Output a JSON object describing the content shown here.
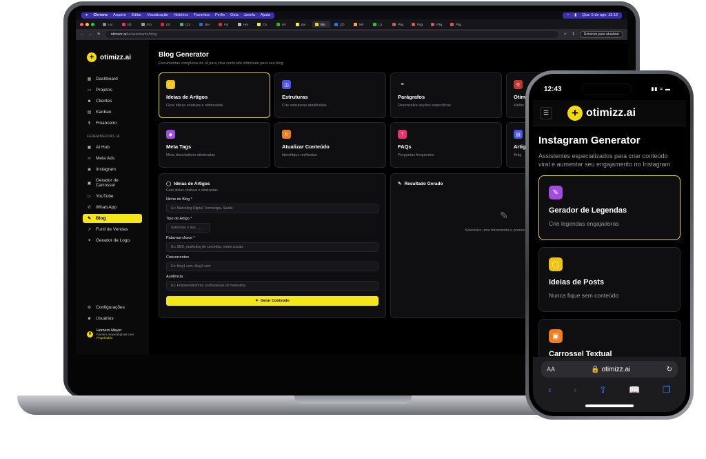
{
  "menubar": {
    "apple": "",
    "app": "Chrome",
    "items": [
      "Arquivo",
      "Editar",
      "Visualização",
      "Histórico",
      "Favoritos",
      "Perfis",
      "Guia",
      "Janela",
      "Ajuda"
    ],
    "clock": "Qua. 6 de ago.  13:13"
  },
  "tabs": [
    {
      "label": "Lor",
      "color": "#888"
    },
    {
      "label": "(6)",
      "color": "#e1306c"
    },
    {
      "label": "Fro",
      "color": "#999"
    },
    {
      "label": "(3)",
      "color": "#d24"
    },
    {
      "label": "(12",
      "color": "#4a8"
    },
    {
      "label": "Ner",
      "color": "#36c"
    },
    {
      "label": "Inb",
      "color": "#c33"
    },
    {
      "label": "Hei",
      "color": "#bbb"
    },
    {
      "label": "Ca",
      "color": "#ee3"
    },
    {
      "label": "(At",
      "color": "#2b2"
    },
    {
      "label": "par",
      "color": "#ff0"
    },
    {
      "label": "Blo",
      "color": "#f5d90a",
      "active": true
    },
    {
      "label": "(20",
      "color": "#1877f2"
    },
    {
      "label": "Mil",
      "color": "#fa3"
    },
    {
      "label": "La",
      "color": "#1c4"
    },
    {
      "label": "Pág",
      "color": "#c55"
    },
    {
      "label": "Pág",
      "color": "#c55"
    },
    {
      "label": "Pág",
      "color": "#c55"
    },
    {
      "label": "Pág",
      "color": "#c55"
    }
  ],
  "addressbar": {
    "url_host": "otimizz.ai",
    "url_path": "/ia/assistants/blog",
    "restart_label": "Reiniciar para atualizar"
  },
  "brand": {
    "name": "otimizz.ai",
    "accent": "#f5e619"
  },
  "sidebar": {
    "items": [
      {
        "label": "Dashboard",
        "icon": "grid-icon"
      },
      {
        "label": "Projetos",
        "icon": "folder-icon"
      },
      {
        "label": "Clientes",
        "icon": "users-icon"
      },
      {
        "label": "Kanban",
        "icon": "kanban-icon"
      },
      {
        "label": "Financeiro",
        "icon": "dollar-icon"
      }
    ],
    "section_label": "FERRAMENTAS IA",
    "tools": [
      {
        "label": "AI Hub",
        "icon": "ai-hub-icon"
      },
      {
        "label": "Meta Ads",
        "icon": "meta-icon"
      },
      {
        "label": "Instagram",
        "icon": "camera-icon"
      },
      {
        "label": "Gerador de Carrossel",
        "icon": "image-icon"
      },
      {
        "label": "YouTube",
        "icon": "play-icon"
      },
      {
        "label": "WhatsApp",
        "icon": "whatsapp-icon"
      },
      {
        "label": "Blog",
        "icon": "blog-icon",
        "active": true
      },
      {
        "label": "Funil de Vendas",
        "icon": "trend-icon"
      },
      {
        "label": "Gerador de Logo",
        "icon": "sparkle-icon"
      }
    ],
    "settings_label": "Configurações",
    "users_label": "Usuários",
    "user": {
      "initial": "H",
      "name": "Homero Meyer",
      "email": "homero.meyer@gmail.com",
      "role": "Proprietário"
    }
  },
  "main": {
    "title": "Blog Generator",
    "subtitle": "Ferramentas completas de IA para criar conteúdo otimizado para seu blog",
    "cards": [
      {
        "title": "Ideias de Artigos",
        "desc": "Gere ideias criativas e otimizadas",
        "icon": "lightbulb-icon",
        "color": "#f5c20a",
        "selected": true
      },
      {
        "title": "Estruturas",
        "desc": "Crie estruturas detalhadas",
        "icon": "layers-icon",
        "color": "#4b56e8"
      },
      {
        "title": "Parágrafos",
        "desc": "Desenvolva seções específicas",
        "icon": "paragraph-icon",
        "color": "#0f0f12"
      },
      {
        "title": "Otim",
        "desc": "Melho",
        "icon": "search-icon",
        "color": "#c0392b"
      },
      {
        "title": "Meta Tags",
        "desc": "Meta descriptions otimizadas",
        "icon": "tag-icon",
        "color": "#a34de0"
      },
      {
        "title": "Atualizar Conteúdo",
        "desc": "Identifique melhorias",
        "icon": "refresh-icon",
        "color": "#f07e1a"
      },
      {
        "title": "FAQs",
        "desc": "Perguntas frequentes",
        "icon": "help-icon",
        "color": "#e6336c"
      },
      {
        "title": "Artig",
        "desc": "Artig",
        "icon": "book-icon",
        "color": "#4b56e8"
      }
    ],
    "form": {
      "title": "Ideias de Artigos",
      "subtitle": "Gere ideias criativas e otimizadas",
      "fields": [
        {
          "label": "Nicho do Blog *",
          "placeholder": "Ex: Marketing Digital, Tecnologia, Saúde"
        },
        {
          "label": "Tipo de Artigo *",
          "placeholder": "Selecione o tipo",
          "select": true
        },
        {
          "label": "Palavras-chave *",
          "placeholder": "Ex: SEO, marketing de conteúdo, redes sociais"
        },
        {
          "label": "Concorrentes",
          "placeholder": "Ex: blog1.com, blog2.com"
        },
        {
          "label": "Audiência",
          "placeholder": "Ex: Empreendedores, profissionais de marketing"
        }
      ],
      "button": "Gerar Conteúdo"
    },
    "result": {
      "title": "Resultado Gerado",
      "empty_text": "Selecione uma ferramenta e preencha o formu"
    }
  },
  "phone": {
    "time": "12:43",
    "title": "Instagram Generator",
    "subtitle": "Assistentes especializados para criar conteúdo viral e aumentar seu engajamento no Instagram",
    "cards": [
      {
        "title": "Gerador de Legendas",
        "desc": "Crie legendas engajadoras",
        "icon": "pen-icon",
        "color": "#a34de0",
        "selected": true
      },
      {
        "title": "Ideias de Posts",
        "desc": "Nunca fique sem conteúdo",
        "icon": "lightbulb-icon",
        "color": "#f5c20a"
      },
      {
        "title": "Carrossel Textual",
        "desc": "",
        "icon": "image-icon",
        "color": "#f07e1a"
      }
    ],
    "safari": {
      "aa": "AA",
      "domain": "otimizz.ai"
    }
  }
}
